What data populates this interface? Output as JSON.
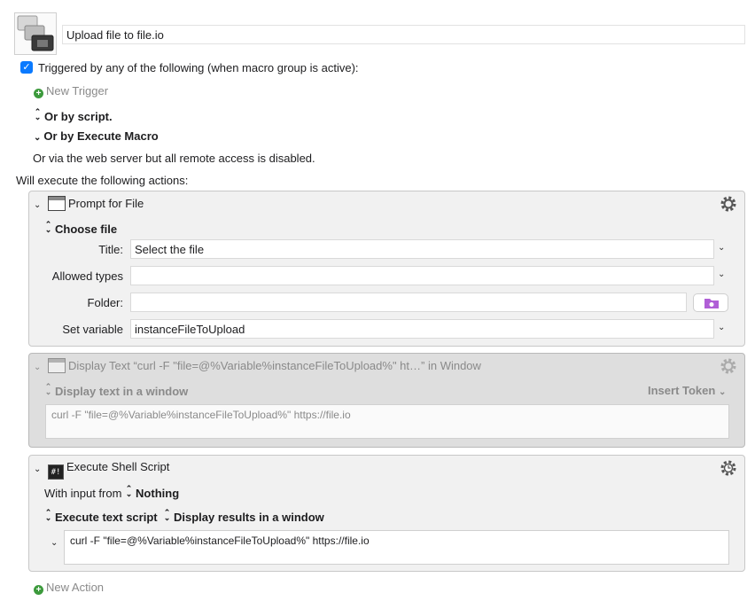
{
  "macro": {
    "name": "Upload file to file.io",
    "icon": "macro-windows-icon"
  },
  "triggers": {
    "checkbox_checked": true,
    "header": "Triggered by any of the following (when macro group is active):",
    "new_trigger": "New Trigger",
    "or_by_script": "Or by script.",
    "or_by_execute_macro": "Or by Execute Macro",
    "web_server": "Or via the web server but all remote access is disabled."
  },
  "actions_header": "Will execute the following actions:",
  "prompt_for_file": {
    "title": "Prompt for File",
    "mode": "Choose file",
    "title_label": "Title:",
    "title_value": "Select the file",
    "allowed_types_label": "Allowed types",
    "allowed_types_value": "",
    "folder_label": "Folder:",
    "folder_value": "",
    "set_variable_label": "Set variable",
    "set_variable_value": "instanceFileToUpload"
  },
  "display_text": {
    "title": "Display Text “curl -F \"file=@%Variable%instanceFileToUpload%\" ht…” in Window",
    "mode": "Display text in a window",
    "insert_token": "Insert Token",
    "text": "curl -F \"file=@%Variable%instanceFileToUpload%\" https://file.io"
  },
  "shell_script": {
    "title": "Execute Shell Script",
    "input_prefix": "With input from",
    "input_value": "Nothing",
    "script_mode": "Execute text script",
    "results_mode": "Display results in a window",
    "script": "curl -F \"file=@%Variable%instanceFileToUpload%\" https://file.io"
  },
  "new_action": "New Action",
  "colors": {
    "accent": "#0a7aff",
    "add_green": "#3c9a3c",
    "folder_purple": "#b05fd6"
  }
}
